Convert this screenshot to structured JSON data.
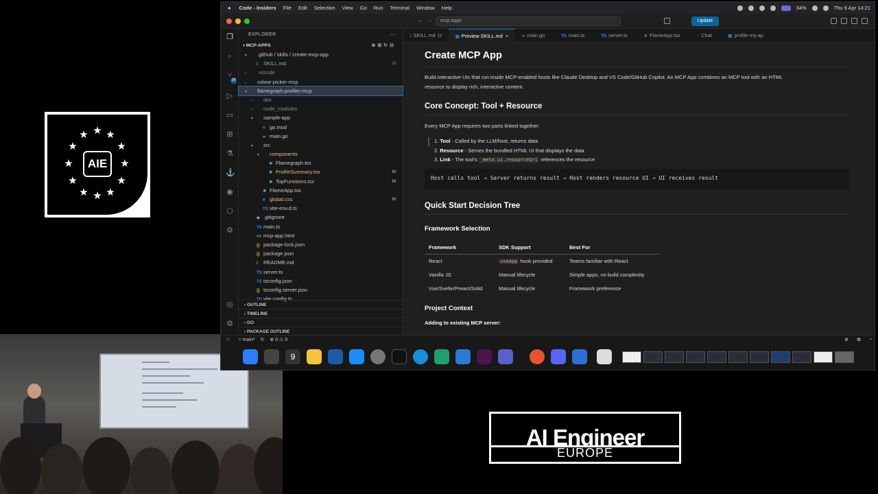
{
  "aie_logo": {
    "text": "AIE"
  },
  "brand": {
    "title": "AI Engineer",
    "subtitle": "EUROPE"
  },
  "menubar": {
    "app_name": "Code - Insiders",
    "items": [
      "File",
      "Edit",
      "Selection",
      "View",
      "Go",
      "Run",
      "Terminal",
      "Window",
      "Help"
    ],
    "battery": "34%",
    "clock": "Thu 9 Apr  14:21"
  },
  "titlebar": {
    "search": "mcp-apps",
    "update_label": "Update"
  },
  "explorer": {
    "header": "EXPLORER",
    "root": "MCP-APPS",
    "rows": [
      {
        "indent": 1,
        "chev": "▾",
        "icon": "",
        "label": ".github / skills / create-mcp-app",
        "cls": "",
        "status": ""
      },
      {
        "indent": 2,
        "chev": "",
        "icon": "i",
        "label": "SKILL.md",
        "cls": "c-git",
        "status": "U"
      },
      {
        "indent": 1,
        "chev": "›",
        "icon": "",
        "label": ".vscode",
        "cls": "c-dim",
        "status": ""
      },
      {
        "indent": 1,
        "chev": "›",
        "icon": "",
        "label": "colour-picker-mcp",
        "cls": "",
        "status": ""
      },
      {
        "indent": 1,
        "chev": "▾",
        "icon": "",
        "label": "flamegraph-profiler-mcp",
        "cls": "",
        "status": "",
        "selected": true
      },
      {
        "indent": 2,
        "chev": "›",
        "icon": "",
        "label": "dist",
        "cls": "c-dim",
        "status": ""
      },
      {
        "indent": 2,
        "chev": "›",
        "icon": "",
        "label": "node_modules",
        "cls": "c-dim",
        "status": ""
      },
      {
        "indent": 2,
        "chev": "▾",
        "icon": "",
        "label": "sample-app",
        "cls": "",
        "status": ""
      },
      {
        "indent": 3,
        "chev": "",
        "icon": "=",
        "label": "go.mod",
        "cls": "",
        "status": ""
      },
      {
        "indent": 3,
        "chev": "",
        "icon": "∞",
        "label": "main.go",
        "cls": "",
        "status": ""
      },
      {
        "indent": 2,
        "chev": "▾",
        "icon": "",
        "label": "src",
        "cls": "c-mod",
        "status": ""
      },
      {
        "indent": 3,
        "chev": "▾",
        "icon": "",
        "label": "components",
        "cls": "c-mod",
        "status": ""
      },
      {
        "indent": 4,
        "chev": "",
        "icon": "⚛",
        "label": "Flamegraph.tsx",
        "cls": "",
        "status": ""
      },
      {
        "indent": 4,
        "chev": "",
        "icon": "⚛",
        "label": "ProfileSummary.tsx",
        "cls": "c-mod",
        "status": "M"
      },
      {
        "indent": 4,
        "chev": "",
        "icon": "⚛",
        "label": "TopFunctions.tsx",
        "cls": "c-mod",
        "status": "M"
      },
      {
        "indent": 3,
        "chev": "",
        "icon": "⚛",
        "label": "FlameApp.tsx",
        "cls": "",
        "status": ""
      },
      {
        "indent": 3,
        "chev": "",
        "icon": "#",
        "label": "global.css",
        "cls": "c-mod",
        "status": "M"
      },
      {
        "indent": 3,
        "chev": "",
        "icon": "TS",
        "label": "vite-env.d.ts",
        "cls": "",
        "status": ""
      },
      {
        "indent": 2,
        "chev": "",
        "icon": "◆",
        "label": ".gitignore",
        "cls": "",
        "status": ""
      },
      {
        "indent": 2,
        "chev": "",
        "icon": "TS",
        "label": "main.ts",
        "cls": "",
        "status": ""
      },
      {
        "indent": 2,
        "chev": "",
        "icon": "<>",
        "label": "mcp-app.html",
        "cls": "",
        "status": ""
      },
      {
        "indent": 2,
        "chev": "",
        "icon": "{}",
        "label": "package-lock.json",
        "cls": "",
        "status": ""
      },
      {
        "indent": 2,
        "chev": "",
        "icon": "{}",
        "label": "package.json",
        "cls": "",
        "status": ""
      },
      {
        "indent": 2,
        "chev": "",
        "icon": "i",
        "label": "README.md",
        "cls": "",
        "status": ""
      },
      {
        "indent": 2,
        "chev": "",
        "icon": "TS",
        "label": "server.ts",
        "cls": "",
        "status": ""
      },
      {
        "indent": 2,
        "chev": "",
        "icon": "TS",
        "label": "tsconfig.json",
        "cls": "",
        "status": ""
      },
      {
        "indent": 2,
        "chev": "",
        "icon": "{}",
        "label": "tsconfig.server.json",
        "cls": "",
        "status": ""
      },
      {
        "indent": 2,
        "chev": "",
        "icon": "TS",
        "label": "vite.config.ts",
        "cls": "",
        "status": ""
      }
    ],
    "sections": [
      "OUTLINE",
      "TIMELINE",
      "GO",
      "PACKAGE OUTLINE"
    ]
  },
  "tabs": [
    {
      "label": "SKILL.md",
      "suffix": "U",
      "icon": "i",
      "active": false
    },
    {
      "label": "Preview SKILL.md",
      "suffix": "×",
      "icon": "▤",
      "active": true
    },
    {
      "label": "main.go",
      "suffix": "",
      "icon": "∞",
      "active": false
    },
    {
      "label": "main.ts",
      "suffix": "",
      "icon": "TS",
      "active": false
    },
    {
      "label": "server.ts",
      "suffix": "",
      "icon": "TS",
      "active": false
    },
    {
      "label": "FlameApp.tsx",
      "suffix": "",
      "icon": "⚛",
      "active": false
    },
    {
      "label": "Chat",
      "suffix": "",
      "icon": "◌",
      "active": false
    },
    {
      "label": "profile-my-ap",
      "suffix": "",
      "icon": "▤",
      "active": false
    }
  ],
  "doc": {
    "title": "Create MCP App",
    "intro_1": "Build interactive UIs that run inside MCP-enabled hosts like Claude Desktop and VS Code/GitHub Copilot. An MCP App combines an MCP tool with an HTML",
    "intro_2": "resource to display rich, interactive content.",
    "h_core": "Core Concept: Tool + Resource",
    "core_para": "Every MCP App requires two parts linked together:",
    "li1_b": "Tool",
    "li1": " - Called by the LLM/host, returns data",
    "li2_b": "Resource",
    "li2": " - Serves the bundled HTML UI that displays the data",
    "li3_b": "Link",
    "li3_pre": " - The tool's ",
    "li3_code": "_meta.ui.resourceUri",
    "li3_post": " references the resource",
    "flow": "Host calls tool → Server returns result → Host renders resource UI → UI receives result",
    "h_quick": "Quick Start Decision Tree",
    "h_framework": "Framework Selection",
    "table_headers": [
      "Framework",
      "SDK Support",
      "Best For"
    ],
    "table_rows": [
      {
        "framework": "React",
        "sdk_code": "useApp",
        "sdk_text": " hook provided",
        "best": "Teams familiar with React"
      },
      {
        "framework": "Vanilla JS",
        "sdk_code": "",
        "sdk_text": "Manual lifecycle",
        "best": "Simple apps, no build complexity"
      },
      {
        "framework": "Vue/Svelte/Preact/Solid",
        "sdk_code": "",
        "sdk_text": "Manual lifecycle",
        "best": "Framework preference"
      }
    ],
    "h_context": "Project Context",
    "context_sub": "Adding to existing MCP server:"
  },
  "statusbar": {
    "branch": "main*",
    "problems": "⊗ 0  ⚠ 0"
  },
  "colors": {
    "accent": "#0078d4",
    "update": "#0e639c",
    "modified": "#e2c08d",
    "untracked": "#73c991"
  }
}
